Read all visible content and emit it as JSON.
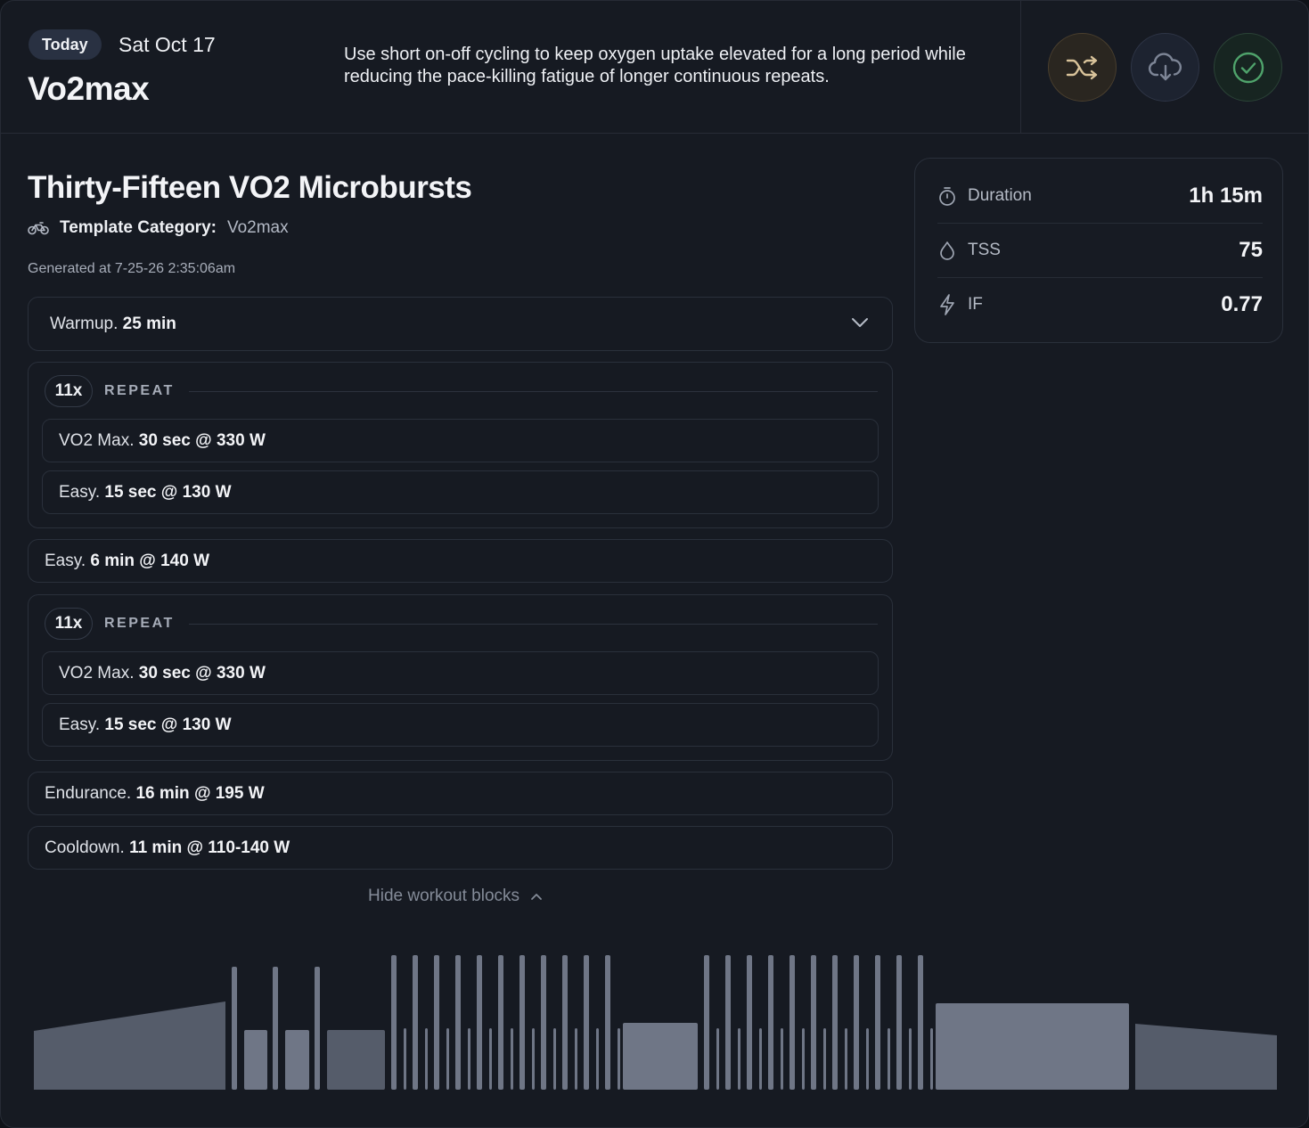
{
  "header": {
    "today_label": "Today",
    "date": "Sat Oct 17",
    "workout_type": "Vo2max",
    "description": "Use short on-off cycling to keep oxygen uptake elevated for a long period while reducing the pace-killing fatigue of longer continuous repeats.",
    "actions": [
      {
        "name": "shuffle",
        "icon": "shuffle-icon",
        "color": "#d9c39a"
      },
      {
        "name": "download",
        "icon": "cloud-download-icon",
        "color": "#7d8596"
      },
      {
        "name": "complete",
        "icon": "check-circle-icon",
        "color": "#4fa36b"
      }
    ]
  },
  "workout": {
    "title": "Thirty-Fifteen VO2 Microbursts",
    "category_label": "Template Category:",
    "category_value": "Vo2max",
    "generated": "Generated at 7-25-26 2:35:06am"
  },
  "blocks": {
    "warmup": {
      "label": "Warmup.",
      "value": "25 min"
    },
    "repeat1": {
      "count": "11x",
      "label": "REPEAT",
      "steps": [
        {
          "label": "VO2 Max.",
          "value": "30 sec @ 330 W"
        },
        {
          "label": "Easy.",
          "value": "15 sec @ 130 W"
        }
      ]
    },
    "easy": {
      "label": "Easy.",
      "value": "6 min @ 140 W"
    },
    "repeat2": {
      "count": "11x",
      "label": "REPEAT",
      "steps": [
        {
          "label": "VO2 Max.",
          "value": "30 sec @ 330 W"
        },
        {
          "label": "Easy.",
          "value": "15 sec @ 130 W"
        }
      ]
    },
    "endurance": {
      "label": "Endurance.",
      "value": "16 min @ 195 W"
    },
    "cooldown": {
      "label": "Cooldown.",
      "value": "11 min @ 110-140 W"
    }
  },
  "hide_blocks_label": "Hide workout blocks",
  "stats": [
    {
      "icon": "stopwatch-icon",
      "label": "Duration",
      "value": "1h 15m"
    },
    {
      "icon": "drop-icon",
      "label": "TSS",
      "value": "75"
    },
    {
      "icon": "lightning-icon",
      "label": "IF",
      "value": "0.77"
    }
  ],
  "colors": {
    "background": "#161a22",
    "block_border": "#2a303b",
    "profile_high": "#6f7686",
    "profile_low": "#555c6a"
  }
}
